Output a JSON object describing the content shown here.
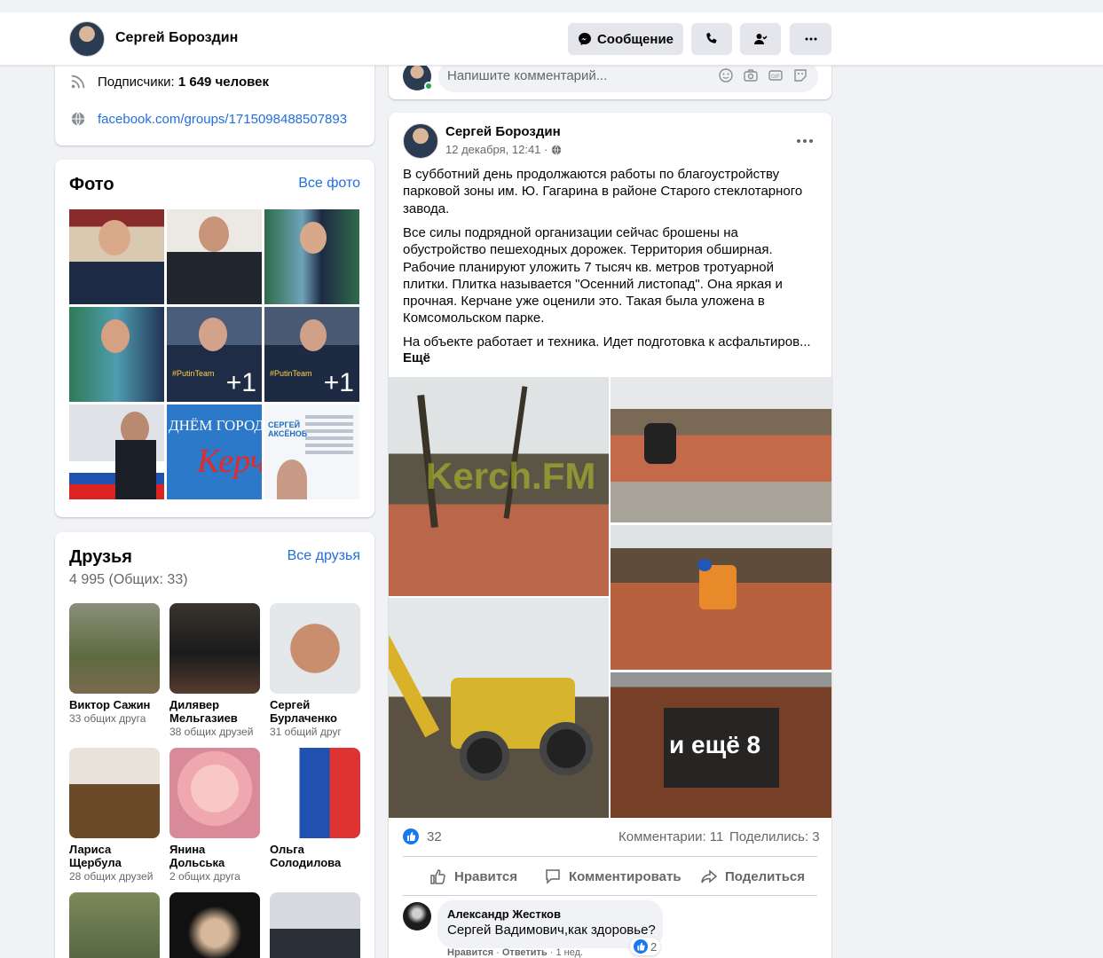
{
  "header": {
    "name": "Сергей Бороздин",
    "message_label": "Сообщение"
  },
  "intro": {
    "followers_label": "Подписчики:",
    "followers_value": "1 649 человек",
    "group_link": "facebook.com/groups/1715098488507893"
  },
  "photos": {
    "title": "Фото",
    "all_link": "Все фото",
    "overlay_plus": "+1",
    "banner_text_1": "ДНЁМ ГОРОД",
    "banner_text_2": "Керч",
    "tag_text": "#PutinTeam",
    "aksenov_text": "СЕРГЕЙ АКСЁНОВ"
  },
  "friends": {
    "title": "Друзья",
    "all_link": "Все друзья",
    "count": "4 995 (Общих: 33)",
    "items": [
      {
        "name": "Виктор Сажин",
        "mutual": "33 общих друга"
      },
      {
        "name": "Дилявер Мельгазиев",
        "mutual": "38 общих друзей"
      },
      {
        "name": "Сергей Бурлаченко",
        "mutual": "31 общий друг"
      },
      {
        "name": "Лариса Щербула",
        "mutual": "28 общих друзей"
      },
      {
        "name": "Янина Дольська",
        "mutual": "2 общих друга"
      },
      {
        "name": "Ольга Солодилова",
        "mutual": ""
      },
      {
        "name": "",
        "mutual": ""
      },
      {
        "name": "",
        "mutual": ""
      },
      {
        "name": "",
        "mutual": ""
      }
    ]
  },
  "composer": {
    "placeholder": "Напишите комментарий..."
  },
  "post": {
    "author": "Сергей Бороздин",
    "date": "12 декабря, 12:41 ·",
    "paragraphs": [
      "В субботний день продолжаются работы по благоустройству парковой зоны им. Ю. Гагарина в районе Старого стеклотарного завода.",
      "Все силы подрядной организации сейчас брошены на обустройство пешеходных дорожек. Территория обширная. Рабочие планируют уложить 7 тысяч кв. метров тротуарной плитки. Плитка называется \"Осенний листопад\". Она яркая и прочная. Керчане уже оценили это. Такая была уложена в Комсомольском парке.",
      "На объекте работает и техника. Идет подготовка к асфальтиров..."
    ],
    "more": "Ещё",
    "watermark": "Kerch.FM",
    "more_photos": "и ещё 8",
    "likes": "32",
    "comments": "Комментарии: 11",
    "shares": "Поделились: 3",
    "actions": {
      "like": "Нравится",
      "comment": "Комментировать",
      "share": "Поделиться"
    }
  },
  "comment": {
    "author": "Александр Жестков",
    "text": "Сергей Вадимович,как здоровье?",
    "like": "Нравится",
    "reply": "Ответить",
    "time": "1 нед.",
    "reactions": "2"
  }
}
